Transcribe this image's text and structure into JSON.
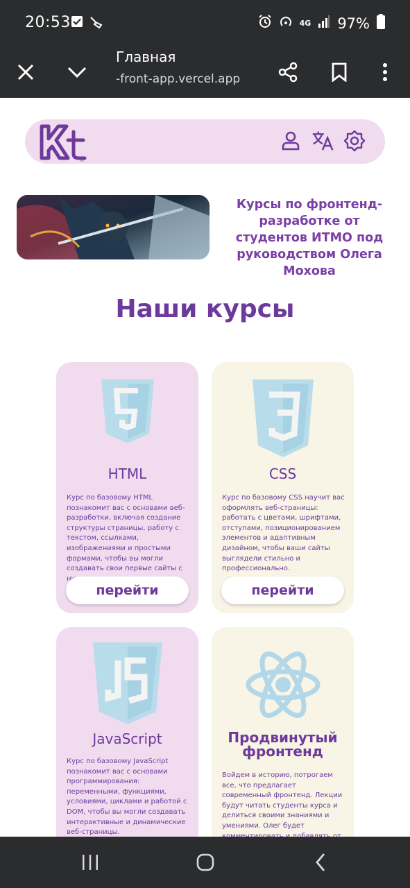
{
  "status_bar": {
    "time": "20:53",
    "network": "4G",
    "battery": "97%",
    "left_icons": [
      "check-box-icon",
      "vacuum-icon"
    ],
    "right_icons": [
      "alarm-icon",
      "hotspot-icon",
      "signal-icon",
      "battery-icon"
    ]
  },
  "browser": {
    "title": "Главная",
    "url": "-front-app.vercel.app",
    "icons": [
      "close-icon",
      "chevron-down-icon",
      "share-icon",
      "bookmark-icon",
      "more-vertical-icon"
    ]
  },
  "header": {
    "logo_text": "Kt",
    "icons": [
      "user-icon",
      "translate-icon",
      "theme-sun-icon"
    ]
  },
  "hero": {
    "text": "Курсы по фронтенд-разработке от студентов ИТМО под руководством Олега Мохова"
  },
  "courses_title": "Наши курсы",
  "courses": [
    {
      "title": "HTML",
      "icon": "html5-icon",
      "description": "Курс по базовому HTML познакомит вас с основами веб-разработки, включая создание структуры страницы, работу с текстом, ссылками, изображениями и простыми формами, чтобы вы могли создавать свои первые сайты с нуля.",
      "button": "перейти"
    },
    {
      "title": "CSS",
      "icon": "css3-icon",
      "description": "Курс по базовому CSS научит вас оформлять веб-страницы: работать с цветами, шрифтами, отступами, позиционированием элементов и адаптивным дизайном, чтобы ваши сайты выглядели стильно и профессионально.",
      "button": "перейти"
    },
    {
      "title": "JavaScript",
      "icon": "js-icon",
      "description": "Курс по базовому JavaScript познакомит вас с основами программирования: переменными, функциями, условиями, циклами и работой с DOM, чтобы вы могли создавать интерактивные и динамические веб-страницы."
    },
    {
      "title": "Продвинутый фронтенд",
      "icon": "react-atom-icon",
      "description": "Войдем в историю, потрогаем все, что предлагает современный фронтенд. Лекции будут читать студенты курса и делиться своими знаниями и умениями. Олег будет комментировать и добавлять от себя к каждой лекции."
    }
  ],
  "nav_bar": {
    "icons": [
      "recent-apps-icon",
      "home-icon",
      "back-icon"
    ]
  },
  "colors": {
    "accent": "#6d3a9c",
    "card_pink": "#f1dcef",
    "card_cream": "#f8f4e6",
    "chrome": "#2b2c2e",
    "icon_blue": "#b9dcea"
  }
}
